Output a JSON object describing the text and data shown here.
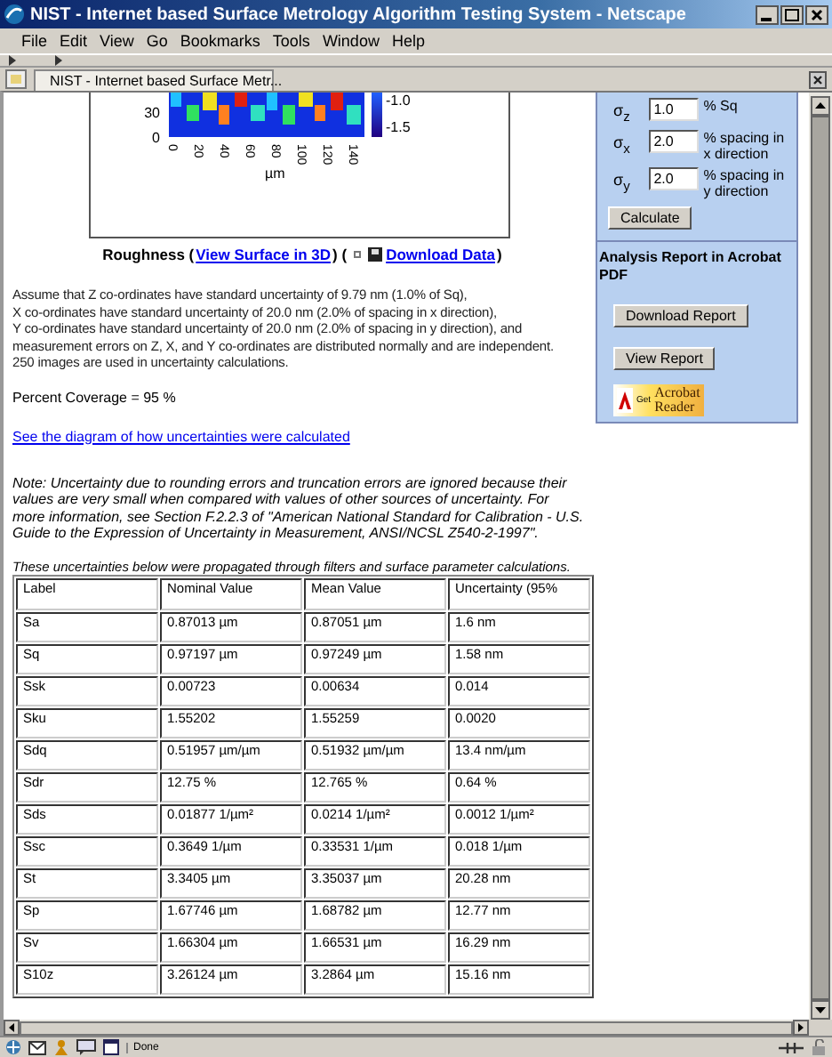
{
  "window": {
    "title": "NIST - Internet based Surface Metrology Algorithm Testing System - Netscape"
  },
  "menu": [
    "File",
    "Edit",
    "View",
    "Go",
    "Bookmarks",
    "Tools",
    "Window",
    "Help"
  ],
  "tabs": [
    {
      "label": "NIST - Internet based Surface Metr...",
      "selected": true
    }
  ],
  "plot": {
    "colorbar_ticks": [
      "-1.0",
      "-1.5"
    ],
    "y_ticks": [
      "30",
      "0"
    ],
    "x_ticks": [
      "0",
      "20",
      "40",
      "60",
      "80",
      "100",
      "120",
      "140"
    ],
    "x_label": "µm"
  },
  "caption": [
    {
      "kind": "text",
      "text": "Roughness ("
    },
    {
      "kind": "link",
      "text": "View Surface in 3D"
    },
    {
      "kind": "text",
      "text": ") ("
    },
    {
      "kind": "download",
      "text": "Download Data"
    },
    {
      "kind": "text",
      "text": ")"
    }
  ],
  "assumptions": [
    "Assume that Z co-ordinates have standard uncertainty of 9.79 nm (1.0% of Sq),",
    "X co-ordinates have standard uncertainty of 20.0 nm (2.0% of spacing in x direction),",
    "Y co-ordinates have standard uncertainty of 20.0 nm (2.0% of spacing in y direction), and",
    "measurement errors on Z, X, and Y co-ordinates are distributed normally and are independent.",
    "250 images are used in uncertainty calculations."
  ],
  "coverage": "Percent Coverage = 95 %",
  "diagram_link": "See the diagram of how uncertainties were calculated",
  "note": "Note: Uncertainty due to rounding errors and truncation errors are ignored because their values are very small when compared with values of other sources of uncertainty.  For more information,  see Section F.2.2.3 of \"American National Standard for Calibration - U.S. Guide to the Expression of Uncertainty in Measurement, ANSI/NCSL Z540-2-1997\".",
  "table_intro": "These uncertainties below were propagated through filters and surface parameter calculations.",
  "table": {
    "columns": [
      "Label",
      "Nominal Value",
      "Mean Value",
      "Uncertainty (95%"
    ],
    "rows": [
      [
        "Sa",
        "0.87013 µm",
        "0.87051 µm",
        "1.6 nm"
      ],
      [
        "Sq",
        "0.97197 µm",
        "0.97249 µm",
        "1.58 nm"
      ],
      [
        "Ssk",
        "0.00723",
        "0.00634",
        "0.014"
      ],
      [
        "Sku",
        "1.55202",
        "1.55259",
        "0.0020"
      ],
      [
        "Sdq",
        "0.51957 µm/µm",
        "0.51932 µm/µm",
        "13.4 nm/µm"
      ],
      [
        "Sdr",
        "12.75 %",
        "12.765 %",
        "0.64 %"
      ],
      [
        "Sds",
        "0.01877 1/µm²",
        "0.0214 1/µm²",
        "0.0012 1/µm²"
      ],
      [
        "Ssc",
        "0.3649 1/µm",
        "0.33531 1/µm",
        "0.018 1/µm"
      ],
      [
        "St",
        "3.3405 µm",
        "3.35037 µm",
        "20.28 nm"
      ],
      [
        "Sp",
        "1.67746 µm",
        "1.68782 µm",
        "12.77 nm"
      ],
      [
        "Sv",
        "1.66304 µm",
        "1.66531 µm",
        "16.29 nm"
      ],
      [
        "S10z",
        "3.26124 µm",
        "3.2864 µm",
        "15.16 nm"
      ]
    ]
  },
  "sidebar": {
    "params": [
      {
        "label": "σ$_{z}$",
        "value": "1.0",
        "unit": "% Sq"
      },
      {
        "label": "σ$_{x}$",
        "value": "2.0",
        "unit": "% spacing in x direction"
      },
      {
        "label": "σ$_{y}$",
        "value": "2.0",
        "unit": "% spacing in y direction"
      }
    ],
    "calculate": "Calculate",
    "report_heading": "Analysis Report in Acrobat PDF",
    "buttons": [
      "Download Report",
      "View Report"
    ],
    "badge": {
      "get": "Get",
      "lines": [
        "Acrobat",
        "Reader"
      ]
    }
  },
  "status_bar": {
    "text": "Done"
  }
}
